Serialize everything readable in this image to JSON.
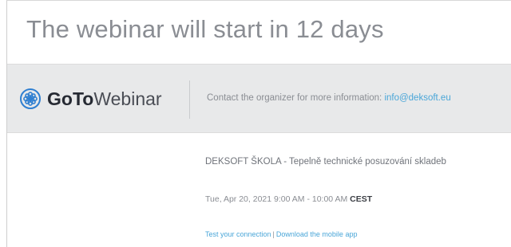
{
  "page": {
    "title": "The webinar will start in 12 days"
  },
  "header": {
    "logo_goto": "GoTo",
    "logo_webinar": "Webinar",
    "contact_text": "Contact the organizer for more information: ",
    "contact_email": "info@deksoft.eu"
  },
  "event": {
    "name": "DEKSOFT ŠKOLA - Tepelně technické posuzování skladeb",
    "time": "Tue, Apr 20, 2021 9:00 AM - 10:00 AM ",
    "timezone": "CEST"
  },
  "links": {
    "test_connection": "Test your connection",
    "separator": "|",
    "download_app": "Download the mobile app"
  },
  "icons": {
    "logo_icon": "gotowebinar-flower-icon"
  },
  "colors": {
    "link": "#4aa6d8",
    "logo_icon": "#2f7fd1",
    "header_band": "#e8e9ea"
  }
}
